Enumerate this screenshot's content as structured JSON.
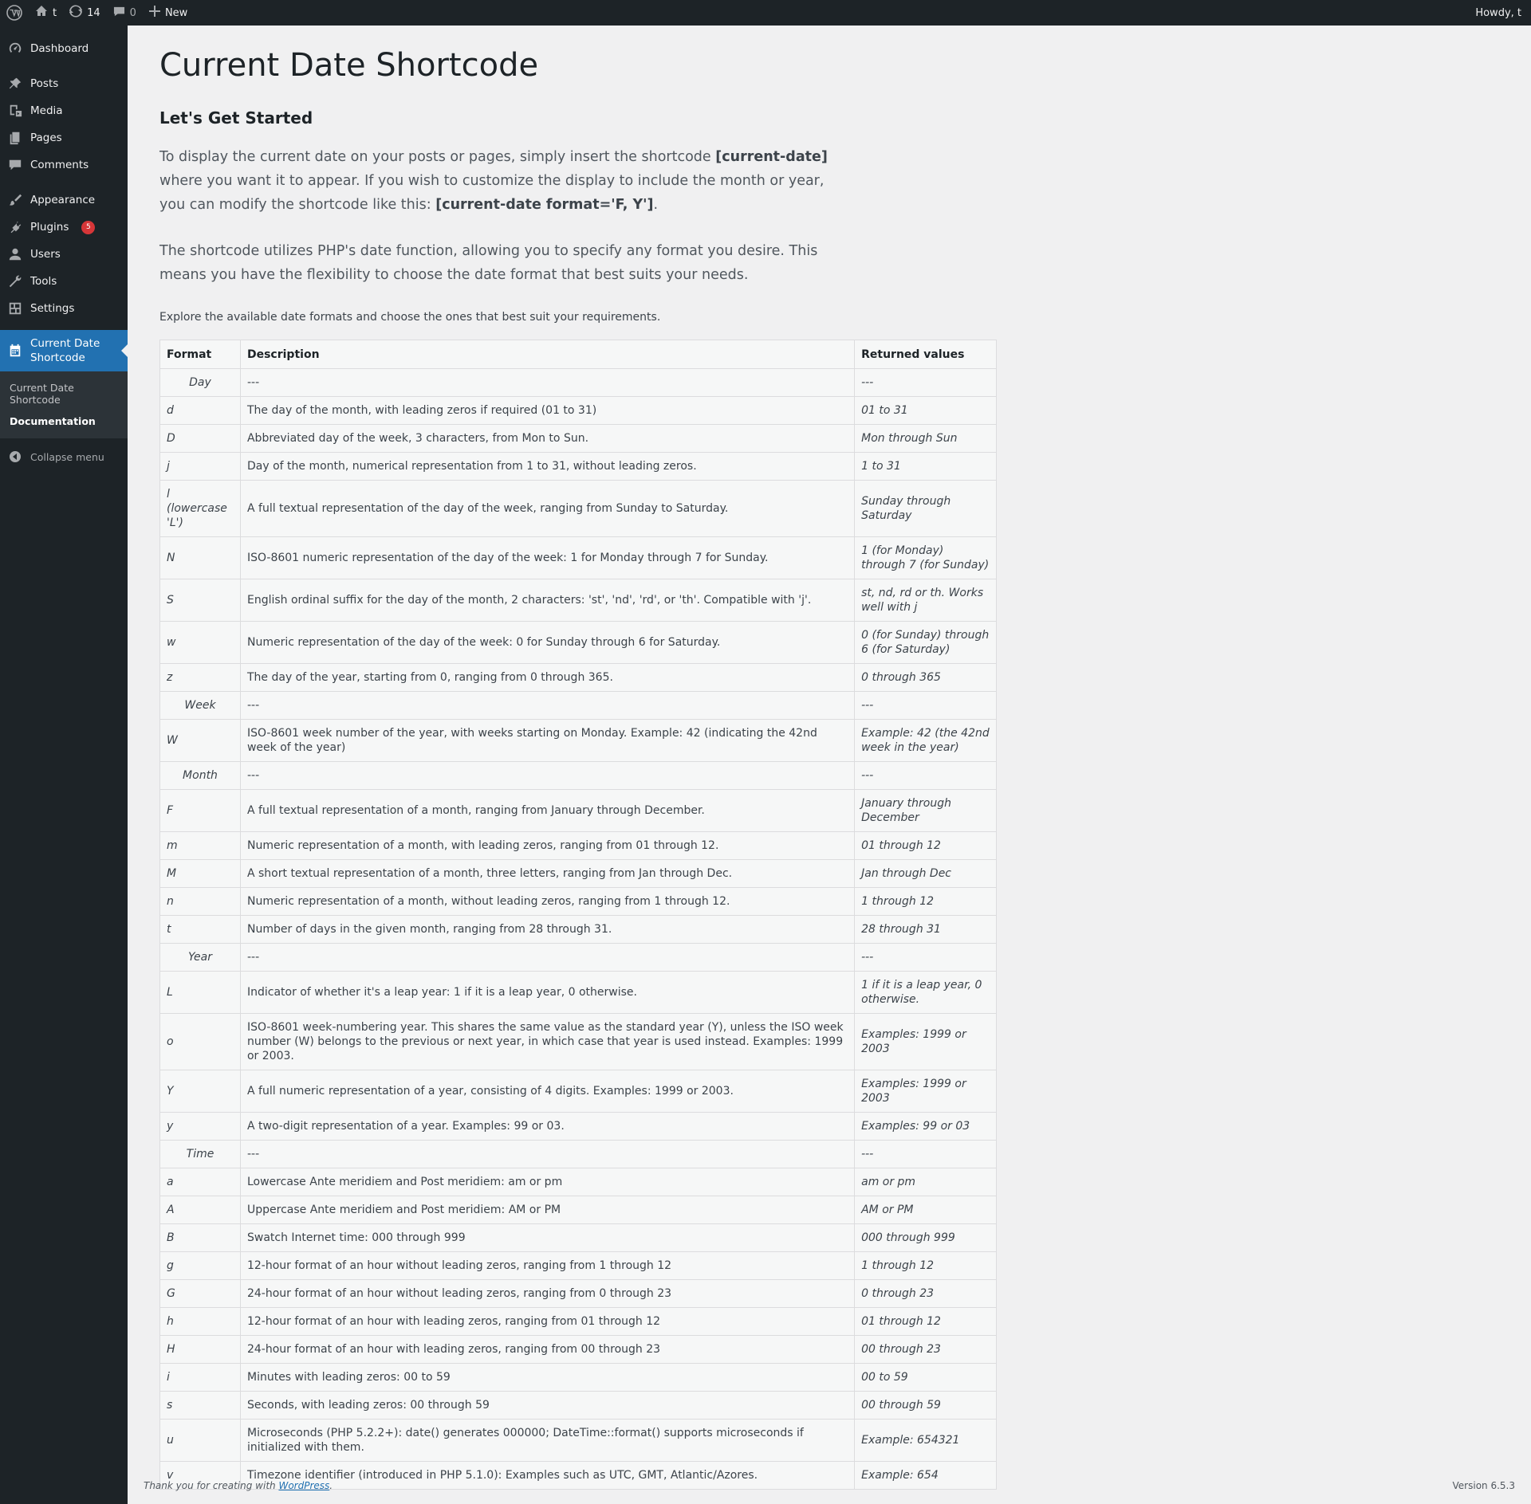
{
  "adminbar": {
    "site": "t",
    "updates": "14",
    "comments": "0",
    "new": "New",
    "howdy": "Howdy, t"
  },
  "sidebar": {
    "items": [
      {
        "label": "Dashboard",
        "icon": "dashboard-icon"
      },
      {
        "label": "Posts",
        "icon": "pin-icon"
      },
      {
        "label": "Media",
        "icon": "media-icon"
      },
      {
        "label": "Pages",
        "icon": "pages-icon"
      },
      {
        "label": "Comments",
        "icon": "comment-icon"
      },
      {
        "label": "Appearance",
        "icon": "brush-icon"
      },
      {
        "label": "Plugins",
        "icon": "plugin-icon",
        "badge": "5"
      },
      {
        "label": "Users",
        "icon": "users-icon"
      },
      {
        "label": "Tools",
        "icon": "wrench-icon"
      },
      {
        "label": "Settings",
        "icon": "settings-icon"
      }
    ],
    "current": "Current Date Shortcode",
    "submenu": [
      "Current Date Shortcode",
      "Documentation"
    ],
    "collapse": "Collapse menu"
  },
  "page": {
    "title": "Current Date Shortcode",
    "subtitle": "Let's Get Started",
    "p1_a": "To display the current date on your posts or pages, simply insert the shortcode ",
    "p1_code1": "[current-date]",
    "p1_b": " where you want it to appear. If you wish to customize the display to include the month or year, you can modify the shortcode like this: ",
    "p1_code2": "[current-date format='F, Y']",
    "p1_c": ".",
    "p2": "The shortcode utilizes PHP's date function, allowing you to specify any format you desire. This means you have the flexibility to choose the date format that best suits your needs.",
    "explore": "Explore the available date formats and choose the ones that best suit your requirements."
  },
  "table": {
    "headers": [
      "Format",
      "Description",
      "Returned values"
    ],
    "rows": [
      {
        "group": true,
        "f": "Day",
        "d": "---",
        "r": "---"
      },
      {
        "f": "d",
        "d": "The day of the month, with leading zeros if required (01 to 31)",
        "r": "01 to 31"
      },
      {
        "f": "D",
        "d": "Abbreviated day of the week, 3 characters, from Mon to Sun.",
        "r": "Mon through Sun"
      },
      {
        "f": "j",
        "d": "Day of the month, numerical representation from 1 to 31, without leading zeros.",
        "r": "1 to 31"
      },
      {
        "f": "l (lowercase 'L')",
        "d": "A full textual representation of the day of the week, ranging from Sunday to Saturday.",
        "r": "Sunday through Saturday",
        "tall": true
      },
      {
        "f": "N",
        "d": "ISO-8601 numeric representation of the day of the week: 1 for Monday through 7 for Sunday.",
        "r": "1 (for Monday) through 7 (for Sunday)",
        "tall": true
      },
      {
        "f": "S",
        "d": "English ordinal suffix for the day of the month, 2 characters: 'st', 'nd', 'rd', or 'th'. Compatible with 'j'.",
        "r": "st, nd, rd or th. Works well with j",
        "tall": true
      },
      {
        "f": "w",
        "d": "Numeric representation of the day of the week: 0 for Sunday through 6 for Saturday.",
        "r": "0 (for Sunday) through 6 (for Saturday)",
        "tall": true
      },
      {
        "f": "z",
        "d": "The day of the year, starting from 0, ranging from 0 through 365.",
        "r": "0 through 365"
      },
      {
        "group": true,
        "f": "Week",
        "d": "---",
        "r": "---"
      },
      {
        "f": "W",
        "d": "ISO-8601 week number of the year, with weeks starting on Monday. Example: 42 (indicating the 42nd week of the year)",
        "r": "Example: 42 (the 42nd week in the year)",
        "tall": true
      },
      {
        "group": true,
        "f": "Month",
        "d": "---",
        "r": "---"
      },
      {
        "f": "F",
        "d": "A full textual representation of a month, ranging from January through December.",
        "r": "January through December",
        "tall": true
      },
      {
        "f": "m",
        "d": "Numeric representation of a month, with leading zeros, ranging from 01 through 12.",
        "r": "01 through 12"
      },
      {
        "f": "M",
        "d": "A short textual representation of a month, three letters, ranging from Jan through Dec.",
        "r": "Jan through Dec"
      },
      {
        "f": "n",
        "d": "Numeric representation of a month, without leading zeros, ranging from 1 through 12.",
        "r": "1 through 12"
      },
      {
        "f": "t",
        "d": "Number of days in the given month, ranging from 28 through 31.",
        "r": "28 through 31"
      },
      {
        "group": true,
        "f": "Year",
        "d": "---",
        "r": "---"
      },
      {
        "f": "L",
        "d": "Indicator of whether it's a leap year: 1 if it is a leap year, 0 otherwise.",
        "r": "1 if it is a leap year, 0 otherwise.",
        "tall": true
      },
      {
        "f": "o",
        "d": "ISO-8601 week-numbering year. This shares the same value as the standard year (Y), unless the ISO week number (W) belongs to the previous or next year, in which case that year is used instead. Examples: 1999 or 2003.",
        "r": "Examples: 1999 or 2003",
        "tall": true
      },
      {
        "f": "Y",
        "d": "A full numeric representation of a year, consisting of 4 digits. Examples: 1999 or 2003.",
        "r": "Examples: 1999 or 2003"
      },
      {
        "f": "y",
        "d": "A two-digit representation of a year. Examples: 99 or 03.",
        "r": "Examples: 99 or 03"
      },
      {
        "group": true,
        "f": "Time",
        "d": "---",
        "r": "---"
      },
      {
        "f": "a",
        "d": "Lowercase Ante meridiem and Post meridiem: am or pm",
        "r": "am or pm"
      },
      {
        "f": "A",
        "d": "Uppercase Ante meridiem and Post meridiem: AM or PM",
        "r": "AM or PM"
      },
      {
        "f": "B",
        "d": "Swatch Internet time: 000 through 999",
        "r": "000 through 999"
      },
      {
        "f": "g",
        "d": "12-hour format of an hour without leading zeros, ranging from 1 through 12",
        "r": "1 through 12"
      },
      {
        "f": "G",
        "d": "24-hour format of an hour without leading zeros, ranging from 0 through 23",
        "r": "0 through 23"
      },
      {
        "f": "h",
        "d": "12-hour format of an hour with leading zeros, ranging from 01 through 12",
        "r": "01 through 12"
      },
      {
        "f": "H",
        "d": "24-hour format of an hour with leading zeros, ranging from 00 through 23",
        "r": "00 through 23"
      },
      {
        "f": "i",
        "d": "Minutes with leading zeros: 00 to 59",
        "r": "00 to 59"
      },
      {
        "f": "s",
        "d": "Seconds, with leading zeros: 00 through 59",
        "r": "00 through 59"
      },
      {
        "f": "u",
        "d": "Microseconds (PHP 5.2.2+): date() generates 000000; DateTime::format() supports microseconds if initialized with them.",
        "r": "Example: 654321",
        "tall": true
      },
      {
        "f": "v",
        "d": "Timezone identifier (introduced in PHP 5.1.0): Examples such as UTC, GMT, Atlantic/Azores.",
        "r": "Example: 654"
      }
    ]
  },
  "footer": {
    "thanks_pre": "Thank you for creating with ",
    "thanks_link": "WordPress",
    "thanks_post": ".",
    "version": "Version 6.5.3"
  }
}
